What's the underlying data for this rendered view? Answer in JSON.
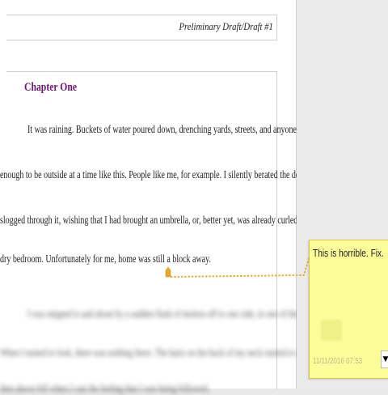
{
  "document": {
    "header": "Preliminary Draft/Draft #1",
    "chapter_title": "Chapter One",
    "lines": [
      "It was raining. Buckets of water poured down, drenching yards, streets, and anyone who was idiotic",
      "enough to be outside at a time like this. People like me, for example. I silently berated the downpour as I",
      "slogged through it, wishing that I had brought an umbrella, or, better yet, was already curled up in my warm,",
      "dry bedroom. Unfortunately for me, home was still a block away."
    ],
    "blurred_lines": [
      "I was stepped to and about by a sudden flash of motion off to one side, in one of the neighbor's yards.",
      "When I turned to look, there was nothing there. The hairs on the back of my neck started to stand on end, as",
      "then above fell when I cast the feeling that I was being followed."
    ]
  },
  "comment": {
    "text": "This is horrible. Fix.",
    "date": "11/11/2016 07:53",
    "menu_icon": "triangle-down-icon",
    "marker_color": "#e3a92a",
    "background_color": "#fdfd9a"
  },
  "colors": {
    "chapter_title": "#6a1670"
  }
}
